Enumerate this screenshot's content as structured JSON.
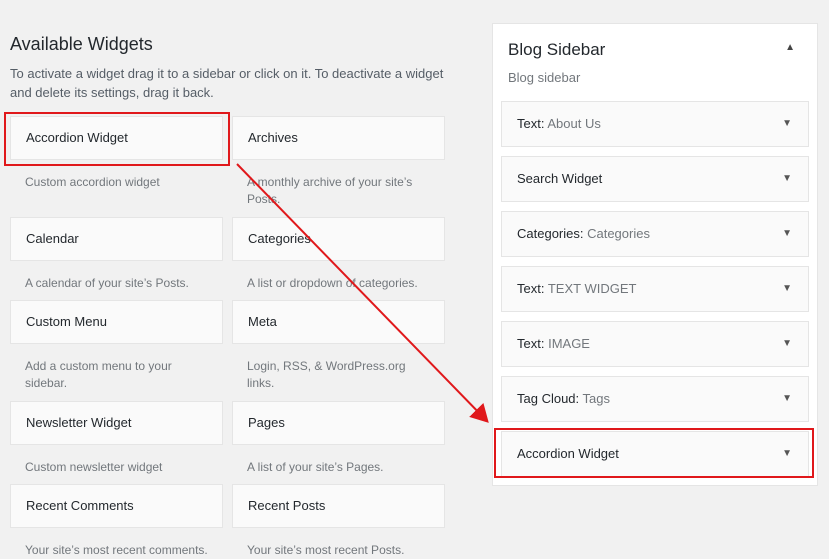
{
  "available": {
    "title": "Available Widgets",
    "intro": "To activate a widget drag it to a sidebar or click on it. To deactivate a widget and delete its settings, drag it back.",
    "widgets": [
      {
        "title": "Accordion Widget",
        "desc": "Custom accordion widget"
      },
      {
        "title": "Archives",
        "desc": "A monthly archive of your site’s Posts."
      },
      {
        "title": "Calendar",
        "desc": "A calendar of your site’s Posts."
      },
      {
        "title": "Categories",
        "desc": "A list or dropdown of categories."
      },
      {
        "title": "Custom Menu",
        "desc": "Add a custom menu to your sidebar."
      },
      {
        "title": "Meta",
        "desc": "Login, RSS, & WordPress.org links."
      },
      {
        "title": "Newsletter Widget",
        "desc": "Custom newsletter widget"
      },
      {
        "title": "Pages",
        "desc": "A list of your site’s Pages."
      },
      {
        "title": "Recent Comments",
        "desc": "Your site’s most recent comments."
      },
      {
        "title": "Recent Posts",
        "desc": "Your site’s most recent Posts."
      }
    ]
  },
  "sidebar": {
    "title": "Blog Sidebar",
    "description": "Blog sidebar",
    "toggle_icon": "▲",
    "widgets": [
      {
        "name": "Text:",
        "instance": " About Us"
      },
      {
        "name": "Search Widget",
        "instance": ""
      },
      {
        "name": "Categories:",
        "instance": " Categories"
      },
      {
        "name": "Text:",
        "instance": " TEXT WIDGET"
      },
      {
        "name": "Text:",
        "instance": " IMAGE"
      },
      {
        "name": "Tag Cloud:",
        "instance": " Tags"
      },
      {
        "name": "Accordion Widget",
        "instance": ""
      }
    ],
    "expand_icon": "▼"
  },
  "colors": {
    "highlight": "#e0181b",
    "background": "#f1f1f1"
  }
}
